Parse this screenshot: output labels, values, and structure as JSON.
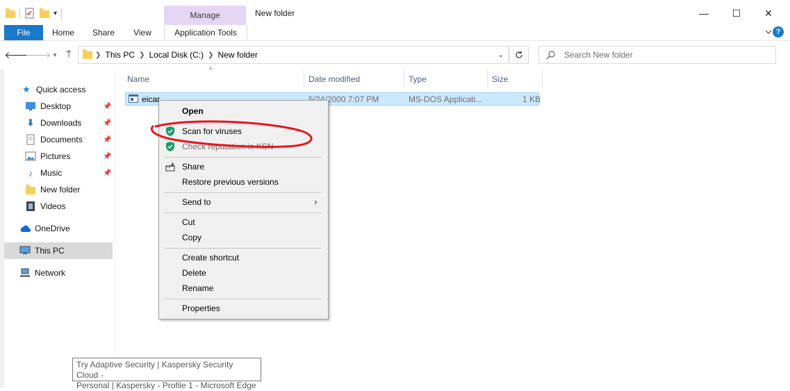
{
  "window": {
    "title": "New folder",
    "manage_tab": "Manage",
    "minimize": "—",
    "maximize": "☐",
    "close": "✕",
    "help": "?"
  },
  "ribbon": {
    "tabs": [
      "File",
      "Home",
      "Share",
      "View",
      "Application Tools"
    ]
  },
  "address": {
    "crumbs": [
      "This PC",
      "Local Disk (C:)",
      "New folder"
    ],
    "search_placeholder": "Search New folder"
  },
  "nav_pane": {
    "quick_access": "Quick access",
    "items": [
      "Desktop",
      "Downloads",
      "Documents",
      "Pictures",
      "Music",
      "New folder",
      "Videos"
    ],
    "onedrive": "OneDrive",
    "this_pc": "This PC",
    "network": "Network"
  },
  "columns": [
    "Name",
    "Date modified",
    "Type",
    "Size"
  ],
  "files": [
    {
      "name": "eicar",
      "date": "5/24/2000 7:07 PM",
      "type": "MS-DOS Applicati...",
      "size": "1 KB"
    }
  ],
  "context_menu": {
    "open": "Open",
    "scan": "Scan for viruses",
    "reputation": "Check reputation in KSN",
    "share": "Share",
    "restore": "Restore previous versions",
    "send_to": "Send to",
    "cut": "Cut",
    "copy": "Copy",
    "create_shortcut": "Create shortcut",
    "delete": "Delete",
    "rename": "Rename",
    "properties": "Properties"
  },
  "tooltip": {
    "line1": "Try Adaptive Security | Kaspersky Security Cloud -",
    "line2": "Personal | Kaspersky - Profile 1 - Microsoft Edge"
  },
  "colors": {
    "file_tab": "#1979ca",
    "manage_tab": "#e6d6f5",
    "selection": "#cce8ff",
    "annotation": "#e8141b",
    "kaspersky_green": "#1a9c6b"
  }
}
